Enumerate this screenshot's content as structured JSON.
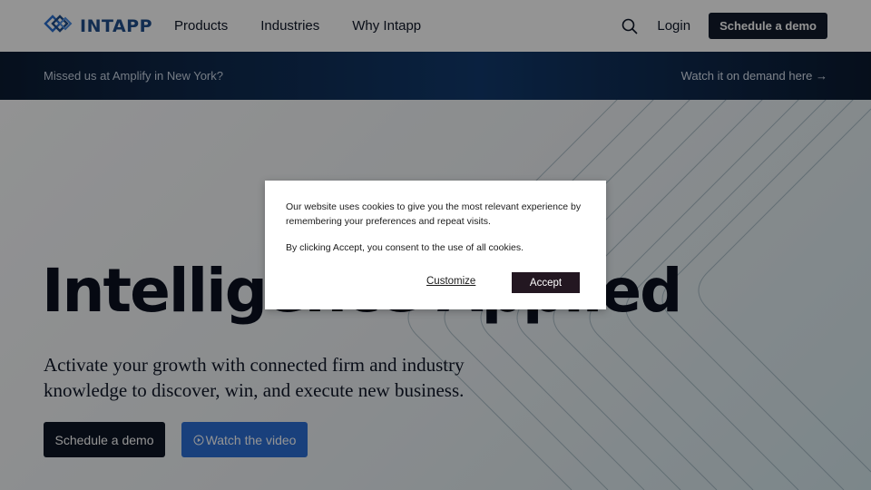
{
  "header": {
    "logo_text": "INTAPP",
    "nav": [
      "Products",
      "Industries",
      "Why Intapp"
    ],
    "login": "Login",
    "demo_button": "Schedule a demo",
    "icons": {
      "logo": "intapp-logo-icon",
      "search": "search-icon"
    }
  },
  "banner": {
    "text": "Missed us at Amplify in New York?",
    "link": "Watch it on demand here →"
  },
  "hero": {
    "title": "Intelligence Applied",
    "subtitle": "Activate your growth with connected firm and industry knowledge to discover, win, and execute new business.",
    "primary_button": "Schedule a demo",
    "secondary_button": "Watch the video",
    "secondary_icon": "play-circle-icon"
  },
  "cookie_modal": {
    "text": "Our website uses cookies to give you the most relevant experience by remembering your preferences and repeat visits.",
    "consent_text": "By clicking Accept, you consent to the use of all cookies.",
    "customize": "Customize",
    "accept": "Accept"
  },
  "colors": {
    "brand_blue": "#1f4e8c",
    "dark_button": "#121a2b",
    "blue_button": "#2b6fd6",
    "accept_button": "#231721",
    "overlay": "rgba(0,0,0,0.42)"
  }
}
